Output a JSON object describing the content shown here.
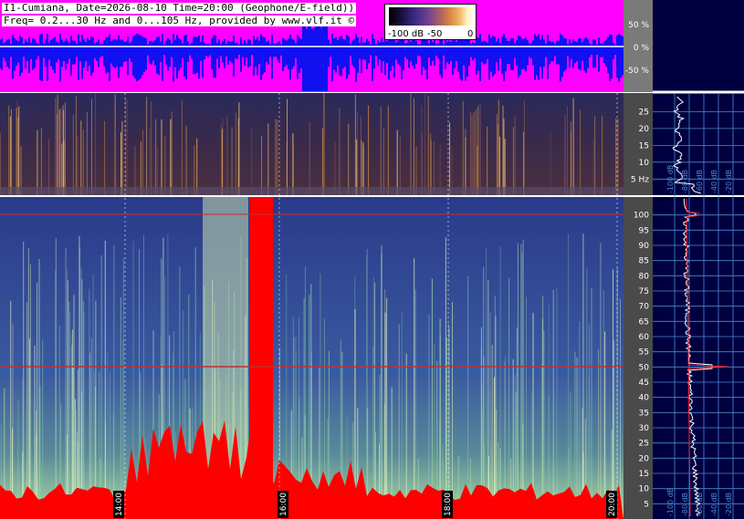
{
  "header": {
    "line1": "I1-Cumiana, Date=2026-08-10 Time=20:00 (Geophone/E-field))",
    "line2": "Freq= 0.2...30 Hz and 0...105 Hz, provided by www.vlf.it ©"
  },
  "colorbar": {
    "labels": [
      "-100 dB",
      "-50",
      "0"
    ]
  },
  "colors": {
    "waveform_bg": "#ff00ff",
    "waveform_trace": "#0000ff",
    "right_panel_bg": "#000040",
    "saturation": "#ff0000",
    "gridline_blue": "#4a8ad0"
  },
  "chart_data": [
    {
      "type": "line",
      "panel": "waveform",
      "yticks": [
        "50 %",
        "0 %",
        "-50 %"
      ],
      "ylim": [
        -100,
        100
      ]
    },
    {
      "type": "heatmap",
      "panel": "spectrogram-low",
      "yticks": [
        "25",
        "20",
        "15",
        "10",
        "5 Hz"
      ],
      "ylim": [
        0.2,
        30
      ]
    },
    {
      "type": "heatmap",
      "panel": "spectrogram-high",
      "yticks": [
        "100",
        "95",
        "90",
        "85",
        "80",
        "75",
        "70",
        "65",
        "60",
        "55",
        "50",
        "45",
        "40",
        "35",
        "30",
        "25",
        "20",
        "15",
        "10",
        "5"
      ],
      "ylim": [
        0,
        105
      ],
      "xticks": [
        "14:00",
        "16:00",
        "18:00",
        "20:00"
      ]
    },
    {
      "type": "line",
      "panel": "average-spectrum",
      "xticks": [
        "-100 dB",
        "-80 dB",
        "-60 dB",
        "-40 dB",
        "-20 dB"
      ]
    }
  ]
}
